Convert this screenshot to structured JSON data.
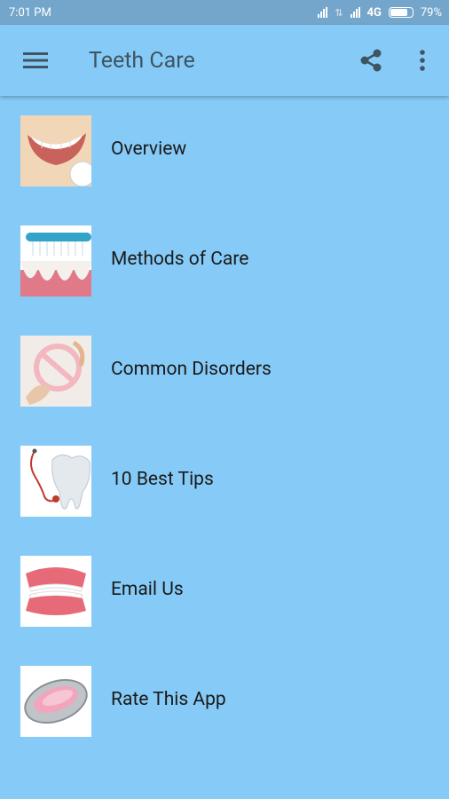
{
  "status": {
    "time": "7:01 PM",
    "network": "4G",
    "battery": "79%",
    "battery_level": 0.79
  },
  "appbar": {
    "title": "Teeth Care"
  },
  "menu": [
    {
      "label": "Overview",
      "icon": "smile-teeth-thumbnail"
    },
    {
      "label": "Methods of Care",
      "icon": "toothbrush-teeth-thumbnail"
    },
    {
      "label": "Common Disorders",
      "icon": "floss-thumbnail"
    },
    {
      "label": "10 Best Tips",
      "icon": "stethoscope-tooth-thumbnail"
    },
    {
      "label": "Email Us",
      "icon": "dentures-thumbnail"
    },
    {
      "label": "Rate This App",
      "icon": "jaw-model-thumbnail"
    }
  ]
}
